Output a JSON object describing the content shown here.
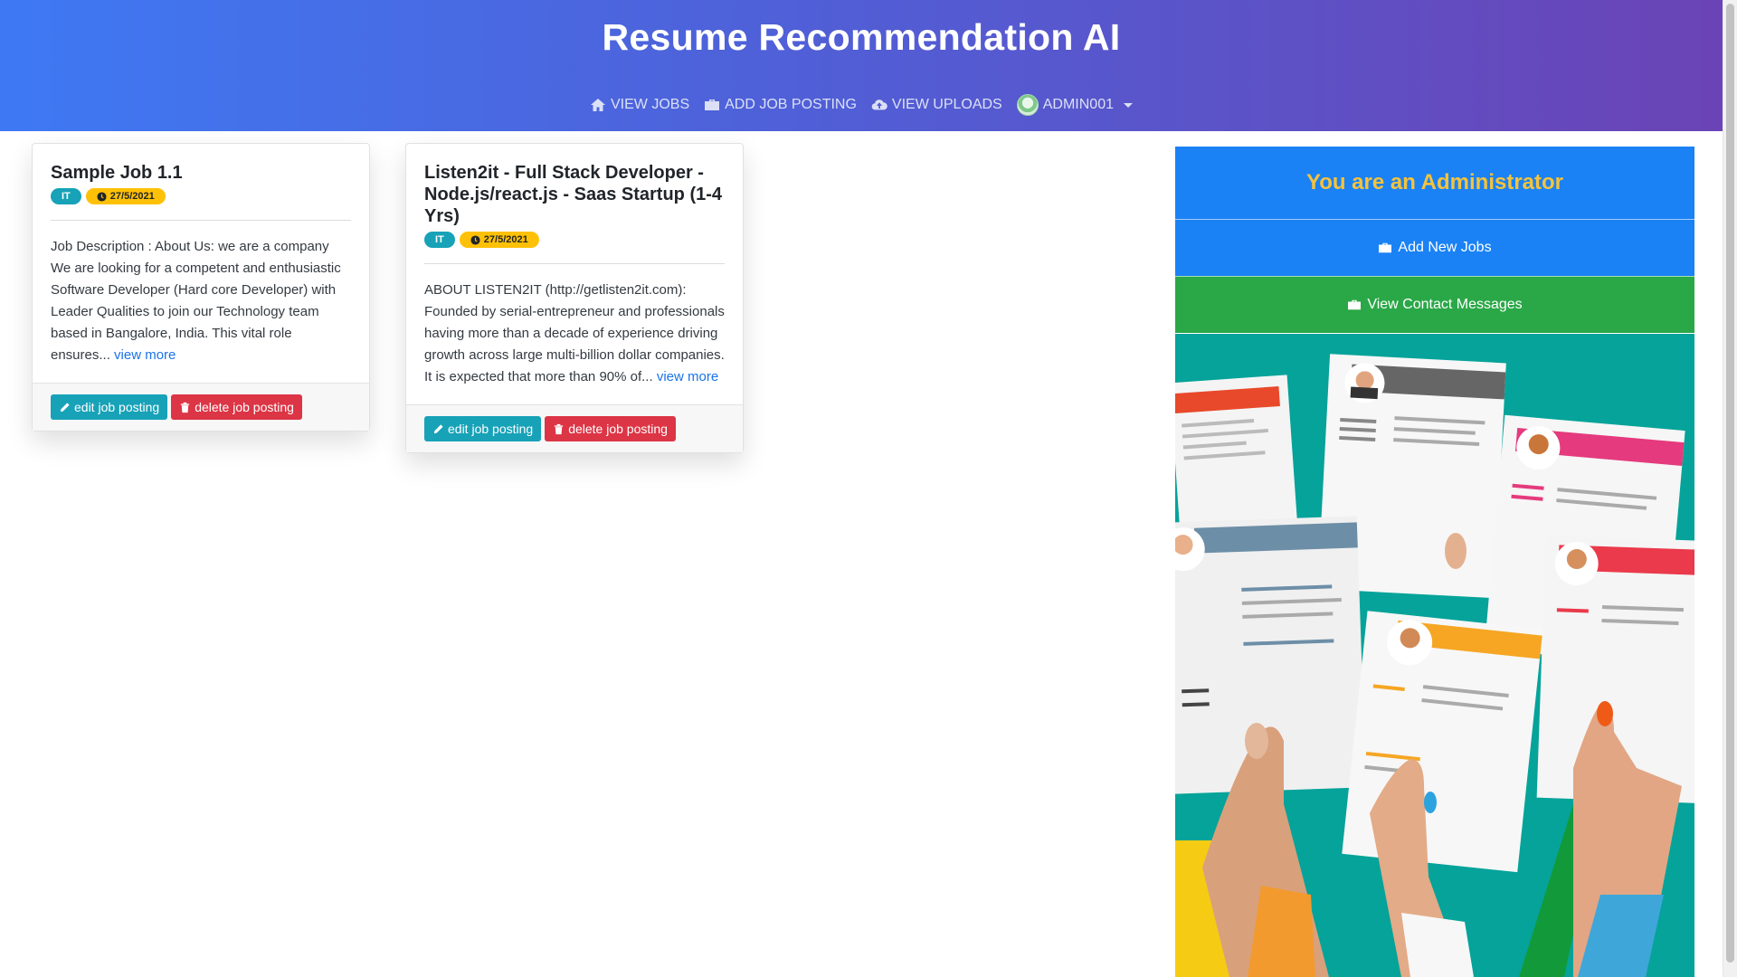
{
  "header": {
    "title": "Resume Recommendation AI",
    "nav": [
      {
        "label": "VIEW JOBS",
        "icon": "home-icon"
      },
      {
        "label": "ADD JOB POSTING",
        "icon": "briefcase-icon"
      },
      {
        "label": "VIEW UPLOADS",
        "icon": "cloud-upload-icon"
      },
      {
        "label": "ADMIN001",
        "icon": "avatar"
      }
    ]
  },
  "jobs": [
    {
      "title": "Sample Job 1.1",
      "category": "IT",
      "date": "27/5/2021",
      "description": "Job Description : About Us: we are a company We are looking for a competent and enthusiastic Software Developer (Hard core Developer) with Leader Qualities to join our Technology team based in Bangalore, India. This vital role ensures...",
      "more_label": "view more",
      "edit_label": "edit job posting",
      "delete_label": "delete job posting"
    },
    {
      "title": "Listen2it - Full Stack Developer - Node.js/react.js - Saas Startup (1-4 Yrs)",
      "category": "IT",
      "date": "27/5/2021",
      "description": "ABOUT LISTEN2IT (http://getlisten2it.com): Founded by serial-entrepreneur and professionals having more than a decade of experience driving growth across large multi-billion dollar companies. It is expected that more than 90% of...",
      "more_label": "view more",
      "edit_label": "edit job posting",
      "delete_label": "delete job posting"
    }
  ],
  "sidebar": {
    "heading": "You are an Administrator",
    "add_jobs_label": "Add New Jobs",
    "contact_label": "View Contact Messages"
  },
  "colors": {
    "header_start": "#3e79f3",
    "header_end": "#6a44b6",
    "badge_category": "#17a2b8",
    "badge_date": "#ffc107",
    "edit_button": "#17a2b8",
    "delete_button": "#dc3545",
    "admin_blue": "#1a82f5",
    "admin_green": "#2aa847",
    "admin_heading_text": "#f6c33a",
    "illustration_bg": "#05a39a"
  }
}
